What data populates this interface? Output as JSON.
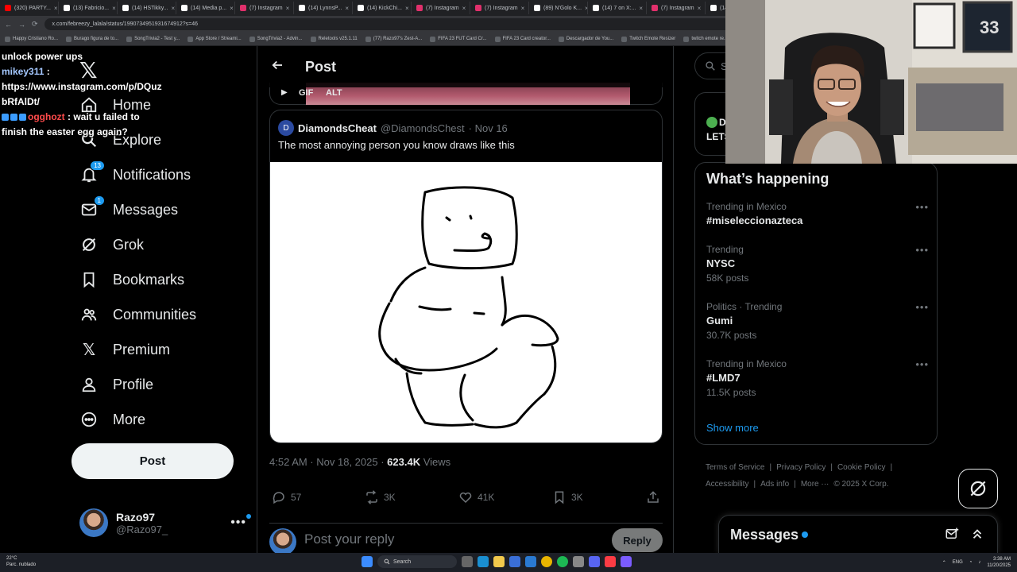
{
  "browser": {
    "tabs": [
      {
        "label": "(320) PARTY...",
        "color": "#ff0000"
      },
      {
        "label": "(13) Fabricio...",
        "color": "#ffffff"
      },
      {
        "label": "(14) HSTikky...",
        "color": "#ffffff"
      },
      {
        "label": "(14) Media p...",
        "color": "#ffffff"
      },
      {
        "label": "(7) Instagram",
        "color": "#e1306c"
      },
      {
        "label": "(14) LynnsP...",
        "color": "#ffffff"
      },
      {
        "label": "(14) KickChi...",
        "color": "#ffffff"
      },
      {
        "label": "(7) Instagram",
        "color": "#e1306c"
      },
      {
        "label": "(7) Instagram",
        "color": "#e1306c"
      },
      {
        "label": "(89) N'Golo K...",
        "color": "#ffffff"
      },
      {
        "label": "(14) 7 on X:...",
        "color": "#ffffff"
      },
      {
        "label": "(7) Instagram",
        "color": "#e1306c"
      },
      {
        "label": "(14) A...",
        "color": "#ffffff"
      }
    ],
    "url": "x.com/febreezy_lalala/status/1990734951931674912?s=46",
    "bookmarks": [
      "Happy Cristiano Ro...",
      "Burago figura de to...",
      "SongTrivia2 - Test y...",
      "App Store / Streami...",
      "SongTrivia2 - Advin...",
      "Reletools v25.1.11",
      "(77) Razo97's Zest-A...",
      "FIFA 23 FUT Card Cr...",
      "FIFA 23 Card creator...",
      "Descargador de You...",
      "Twitch Emote Resizer",
      "twitch emote re..."
    ]
  },
  "chat": [
    {
      "user": "",
      "text": "unlock power ups"
    },
    {
      "user": "mikey311",
      "text": ":"
    },
    {
      "user": "",
      "text": "https://www.instagram.com/p/DQuz"
    },
    {
      "user": "",
      "text": "bRfAlDt/"
    },
    {
      "user": "ogghozt",
      "text": ": wait u failed to"
    },
    {
      "user": "",
      "text": "finish the easter egg again?"
    }
  ],
  "nav": {
    "home": "Home",
    "explore": "Explore",
    "notifications": "Notifications",
    "notifications_badge": "13",
    "messages": "Messages",
    "messages_badge": "1",
    "grok": "Grok",
    "bookmarks": "Bookmarks",
    "communities": "Communities",
    "premium": "Premium",
    "profile": "Profile",
    "more": "More",
    "post_button": "Post"
  },
  "account": {
    "name": "Razo97",
    "handle": "@Razo97_"
  },
  "post": {
    "header_title": "Post",
    "gif_label": "GIF",
    "alt_label": "ALT",
    "quoted": {
      "avatar_letter": "D",
      "name": "DiamondsCheat",
      "handle": "@DiamondsChest",
      "date": "· Nov 16",
      "text": "The most annoying person you know draws like this"
    },
    "timestamp": "4:52 AM · Nov 18, 2025 ·",
    "views_count": "623.4K",
    "views_label": "Views",
    "replies": "57",
    "reposts": "3K",
    "likes": "41K",
    "bookmarks": "3K",
    "reply_placeholder": "Post your reply",
    "reply_button": "Reply"
  },
  "right": {
    "search_placeholder": "S",
    "live_label": "D",
    "live_text": "LETS",
    "happening_title": "What’s happening",
    "trends": [
      {
        "context": "Trending in Mexico",
        "name": "#miseleccionazteca",
        "count": ""
      },
      {
        "context": "Trending",
        "name": "NYSC",
        "count": "58K posts"
      },
      {
        "context": "Politics · Trending",
        "name": "Gumi",
        "count": "30.7K posts"
      },
      {
        "context": "Trending in Mexico",
        "name": "#LMD7",
        "count": "11.5K posts"
      }
    ],
    "show_more": "Show more",
    "footer": [
      "Terms of Service",
      "|",
      "Privacy Policy",
      "|",
      "Cookie Policy",
      "|",
      "Accessibility",
      "|",
      "Ads info",
      "|",
      "More ···",
      "© 2025 X Corp."
    ],
    "messages_title": "Messages"
  },
  "taskbar": {
    "weather_temp": "22°C",
    "weather_desc": "Parc. nublado",
    "search": "Search",
    "lang": "ENG",
    "time": "3:38 AM",
    "date": "11/20/2025"
  },
  "colors": {
    "accent": "#1d9bf0",
    "background": "#000000",
    "border": "#2f3336",
    "muted": "#71767b"
  }
}
